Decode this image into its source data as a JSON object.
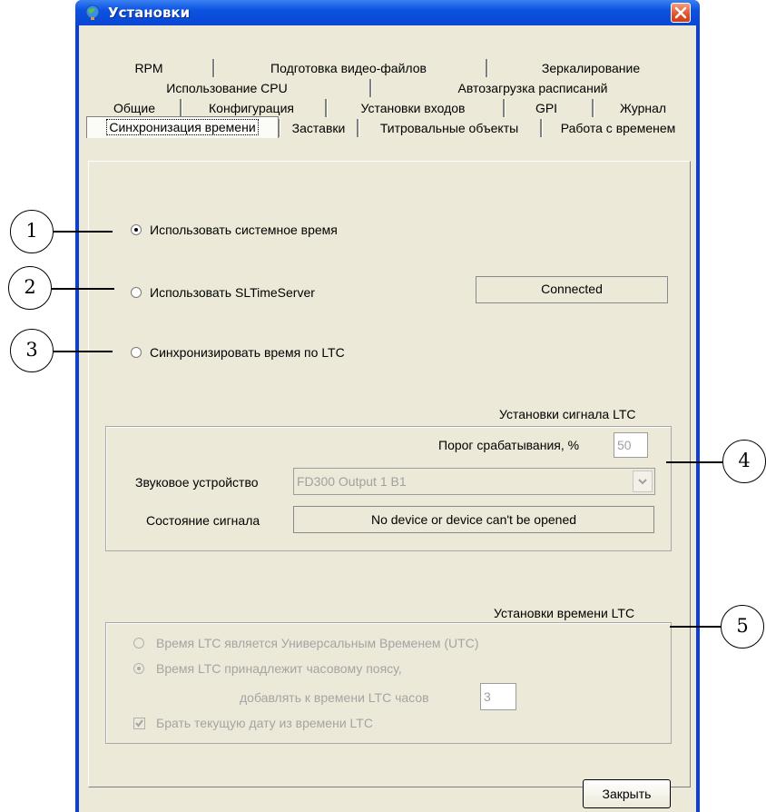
{
  "window": {
    "title": "Установки"
  },
  "tabs": {
    "row1": [
      "RPM",
      "Подготовка видео-файлов",
      "Зеркалирование"
    ],
    "row2": [
      "Использование CPU",
      "Автозагрузка расписаний"
    ],
    "row3": [
      "Общие",
      "Конфигурация",
      "Установки входов",
      "GPI",
      "Журнал"
    ],
    "row4": [
      "Синхронизация времени",
      "Заставки",
      "Титровальные объекты",
      "Работа с временем"
    ],
    "active": "Синхронизация времени"
  },
  "sync_options": {
    "system_time": {
      "label": "Использовать системное время",
      "selected": true
    },
    "sltimeserver": {
      "label": "Использовать SLTimeServer",
      "selected": false,
      "status": "Connected"
    },
    "ltc": {
      "label": "Синхронизировать время по LTC",
      "selected": false
    }
  },
  "ltc_signal": {
    "group_title": "Установки сигнала LTC",
    "threshold_label": "Порог срабатывания, %",
    "threshold_value": "50",
    "device_label": "Звуковое устройство",
    "device_value": "FD300 Output 1 B1",
    "state_label": "Состояние сигнала",
    "state_value": "No device or device can't be opened"
  },
  "ltc_time": {
    "group_title": "Установки времени LTC",
    "utc_label": "Время LTC является Универсальным Временем (UTC)",
    "utc_selected": false,
    "tz_label": "Время LTC принадлежит часовому поясу,",
    "tz_selected": true,
    "hours_label": "добавлять к времени LTC часов",
    "hours_value": "3",
    "date_label": "Брать текущую дату из времени LTC",
    "date_checked": true
  },
  "callouts": [
    "1",
    "2",
    "3",
    "4",
    "5"
  ],
  "footer": {
    "close_label": "Закрыть"
  }
}
